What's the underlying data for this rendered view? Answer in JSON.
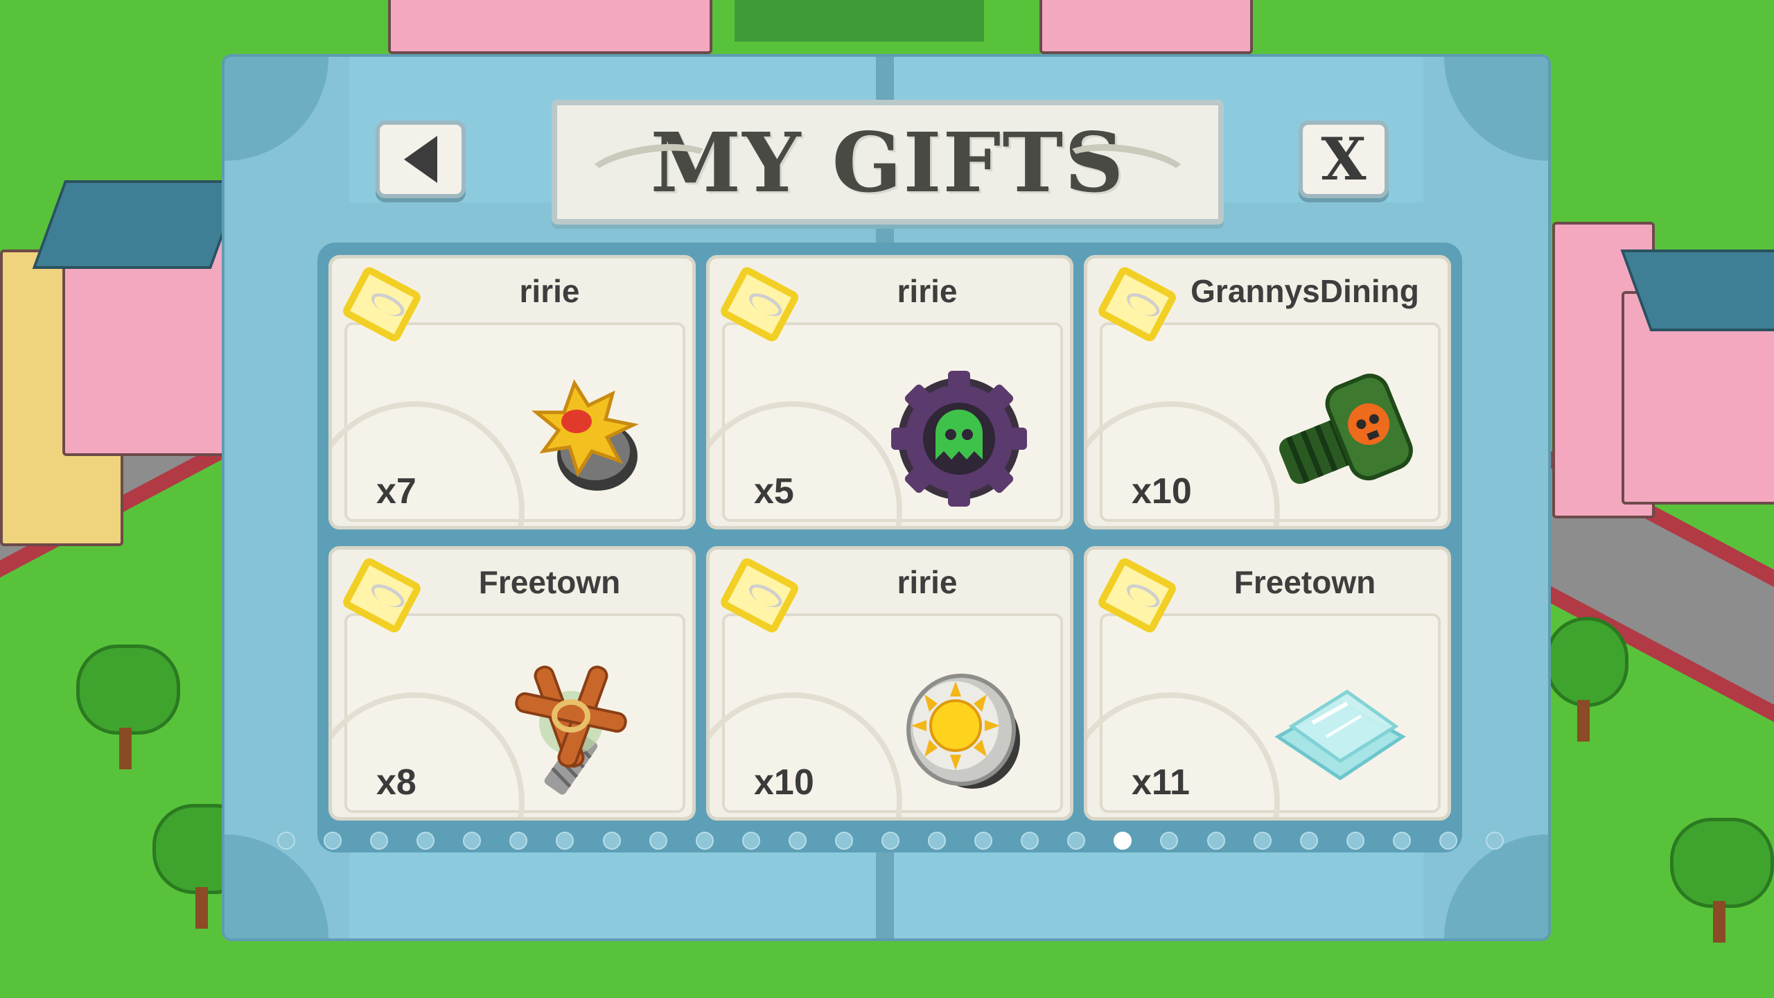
{
  "dialog": {
    "title": "MY GIFTS",
    "close_label": "X"
  },
  "gifts": [
    {
      "sender": "ririe",
      "quantity": "x7",
      "item_icon": "gold-star-gear-icon"
    },
    {
      "sender": "ririe",
      "quantity": "x5",
      "item_icon": "purple-ghost-gear-icon"
    },
    {
      "sender": "GrannysDining",
      "quantity": "x10",
      "item_icon": "green-skull-bolt-icon"
    },
    {
      "sender": "Freetown",
      "quantity": "x8",
      "item_icon": "cinnamon-bundle-bolt-icon"
    },
    {
      "sender": "ririe",
      "quantity": "x10",
      "item_icon": "sun-knob-icon"
    },
    {
      "sender": "Freetown",
      "quantity": "x11",
      "item_icon": "glass-panes-icon"
    }
  ],
  "pager": {
    "page_count": 27,
    "current_page": 19
  },
  "colors": {
    "dialog_frame": "#86c3d6",
    "card_background": "#f2f0e6",
    "tag_gold": "#f2cf25",
    "grass": "#58c33a"
  }
}
